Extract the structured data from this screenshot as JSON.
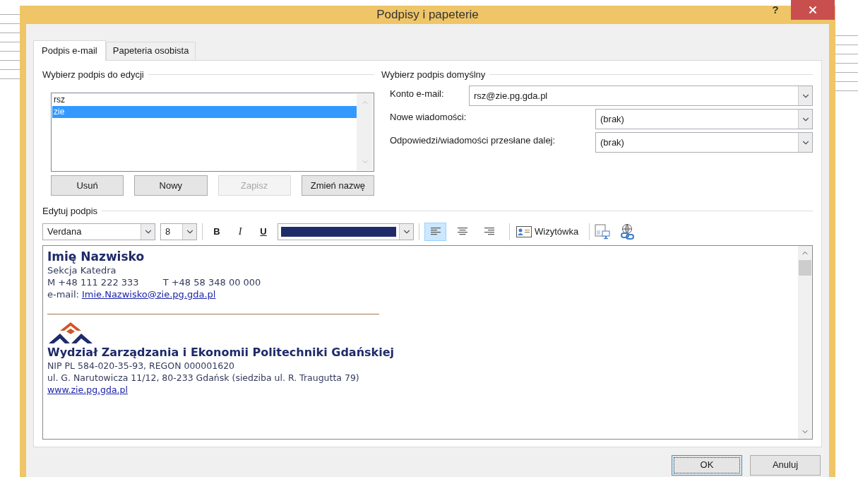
{
  "window": {
    "title": "Podpisy i papeterie",
    "help_label": "?"
  },
  "tabs": [
    {
      "label": "Podpis e-mail",
      "selected": true
    },
    {
      "label": "Papeteria osobista",
      "selected": false
    }
  ],
  "select_section": {
    "title": "Wybierz podpis do edycji",
    "signatures": [
      {
        "name": "rsz",
        "selected": false
      },
      {
        "name": "zie",
        "selected": true
      }
    ],
    "buttons": [
      {
        "label": "Usuń",
        "disabled": false
      },
      {
        "label": "Nowy",
        "disabled": false
      },
      {
        "label": "Zapisz",
        "disabled": true
      },
      {
        "label": "Zmień nazwę",
        "disabled": false
      }
    ]
  },
  "default_section": {
    "title": "Wybierz podpis domyślny",
    "fields": [
      {
        "label": "Konto e-mail:",
        "value": "rsz@zie.pg.gda.pl",
        "kind": "wide"
      },
      {
        "label": "Nowe wiadomości:",
        "value": "(brak)",
        "kind": "narrow"
      },
      {
        "label": "Odpowiedzi/wiadomości przesłane dalej:",
        "value": "(brak)",
        "kind": "narrow"
      }
    ]
  },
  "edit_section": {
    "title": "Edytuj podpis",
    "toolbar": {
      "font": "Verdana",
      "size": "8",
      "bold": "B",
      "italic": "I",
      "underline": "U",
      "alignments": [
        {
          "kind": "left",
          "selected": true
        },
        {
          "kind": "center",
          "selected": false
        },
        {
          "kind": "right",
          "selected": false
        }
      ],
      "business_card": "Wizytówka"
    },
    "lines": [
      {
        "kind": "name",
        "text": "Imię Nazwisko"
      },
      {
        "kind": "text",
        "text": "Sekcja Katedra"
      },
      {
        "kind": "phones",
        "text": "M +48 111 222 333",
        "text2": "T +48 58 348 00 000"
      },
      {
        "kind": "email",
        "text": "e-mail:",
        "link": "Imie.Nazwisko@zie.pg.gda.pl"
      },
      {
        "kind": "rule"
      },
      {
        "kind": "logo"
      },
      {
        "kind": "org",
        "text": "Wydział Zarządzania i Ekonomii Politechniki Gdańskiej"
      },
      {
        "kind": "small",
        "text": "NIP PL 584-020-35-93, REGON 000001620"
      },
      {
        "kind": "small",
        "text": "ul. G. Narutowicza 11/12, 80-233 Gdańsk (siedziba ul. R. Traugutta 79)"
      },
      {
        "kind": "url",
        "link": "www.zie.pg.gda.pl"
      }
    ]
  },
  "footer_buttons": [
    {
      "label": "OK",
      "default": true
    },
    {
      "label": "Anuluj",
      "default": false
    }
  ]
}
